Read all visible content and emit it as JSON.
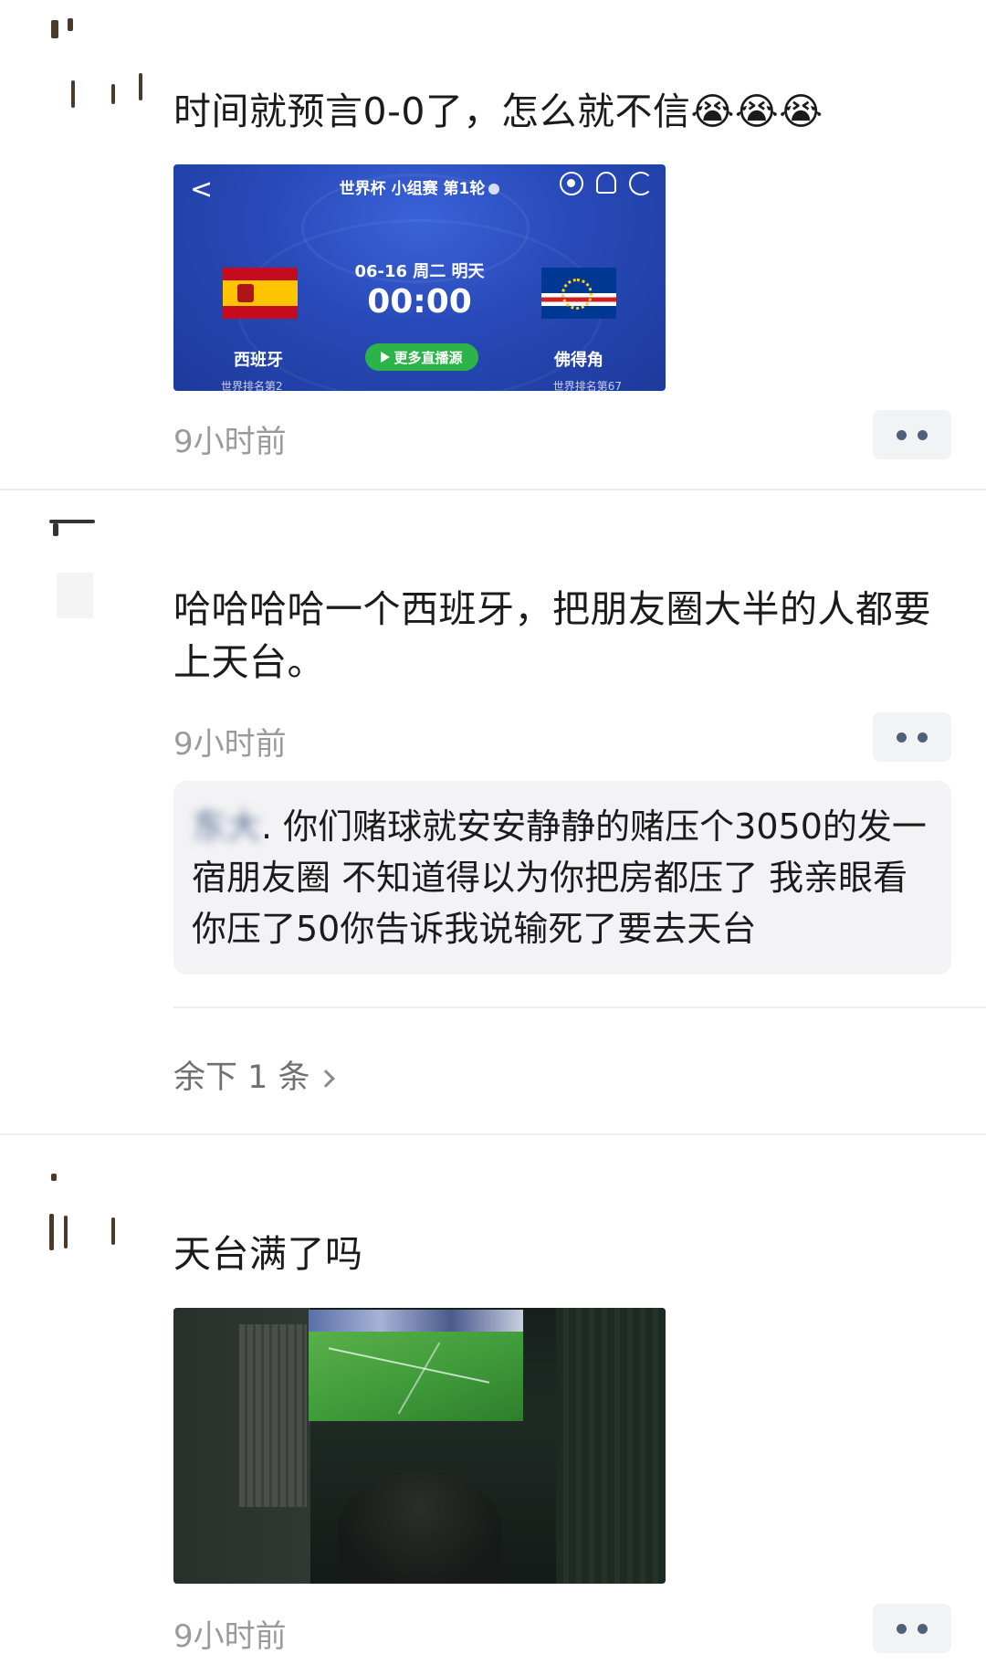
{
  "posts": [
    {
      "text": "时间就预言0-0了，怎么就不信😭😭😭",
      "time": "9小时前",
      "match_card": {
        "back_symbol": "<",
        "title": "世界杯 小组赛 第1轮",
        "date": "06-16 周二 明天",
        "score": "00:00",
        "button_label": "更多直播源",
        "team_left": "西班牙",
        "team_right": "佛得角",
        "rank_left": "世界排名第2",
        "rank_right": "世界排名第67"
      }
    },
    {
      "text": "哈哈哈哈一个西班牙，把朋友圈大半的人都要上天台。",
      "time": "9小时前",
      "comment": {
        "author": "东大",
        "body": ". 你们赌球就安安静静的赌压个3050的发一宿朋友圈 不知道得以为你把房都压了 我亲眼看你压了50你告诉我说输死了要去天台"
      },
      "remaining": "余下 1 条"
    },
    {
      "text": "天台满了吗",
      "time": "9小时前"
    }
  ],
  "colors": {
    "link_blue": "#576b95",
    "time_gray": "#9a9a9a",
    "card_blue": "#2849b8",
    "live_green": "#2cb34a"
  }
}
